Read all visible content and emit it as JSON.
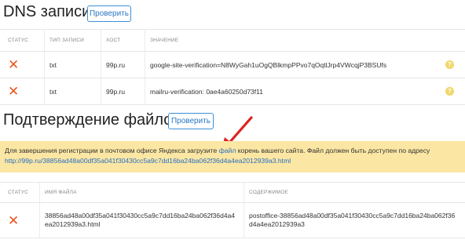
{
  "dns": {
    "title": "DNS записи",
    "check_label": "Проверить",
    "headers": [
      "СТАТУС",
      "ТИП ЗАПИСИ",
      "ХОСТ",
      "ЗНАЧЕНИЕ"
    ],
    "rows": [
      {
        "type": "txt",
        "host": "99p.ru",
        "value": "google-site-verification=N8WyGah1uOgQBlkmpPPvo7qOqtlJrp4VWcqjP3BSUfs",
        "help": "?"
      },
      {
        "type": "txt",
        "host": "99p.ru",
        "value": "mailru-verification: 0ae4a60250d73f11",
        "help": "?"
      }
    ]
  },
  "file": {
    "title": "Подтверждение файлом",
    "check_label": "Проверить",
    "notice_before": "Для завершения регистрации в почтовом офисе Яндекса загрузите ",
    "notice_link": "файл",
    "notice_after": " корень вашего сайта. Файл должен быть доступен по адресу",
    "notice_url": "http://99p.ru/38856ad48a00df35a041f30430cc5a9c7dd16ba24ba062f36d4a4ea2012939a3.html",
    "headers": [
      "СТАТУС",
      "ИМЯ ФАЙЛА",
      "СОДЕРЖИМОЕ"
    ],
    "row": {
      "name_line1": "38856ad48a00df35a041f30430cc5a9c7dd16ba24ba062f36d4a4",
      "name_line2": "ea2012939a3.html",
      "content_line1": "postoffice-38856ad48a00df35a041f30430cc5a9c7dd16ba24ba062f36",
      "content_line2": "d4a4ea2012939a3"
    }
  },
  "colors": {
    "accent": "#2a78c2",
    "error": "#e8581f",
    "notice_bg": "#fbe6a3",
    "help_icon": "#f0d76a"
  },
  "icons": {
    "status_error": "x-icon",
    "help": "question-icon",
    "annotation": "red-arrow-icon"
  }
}
